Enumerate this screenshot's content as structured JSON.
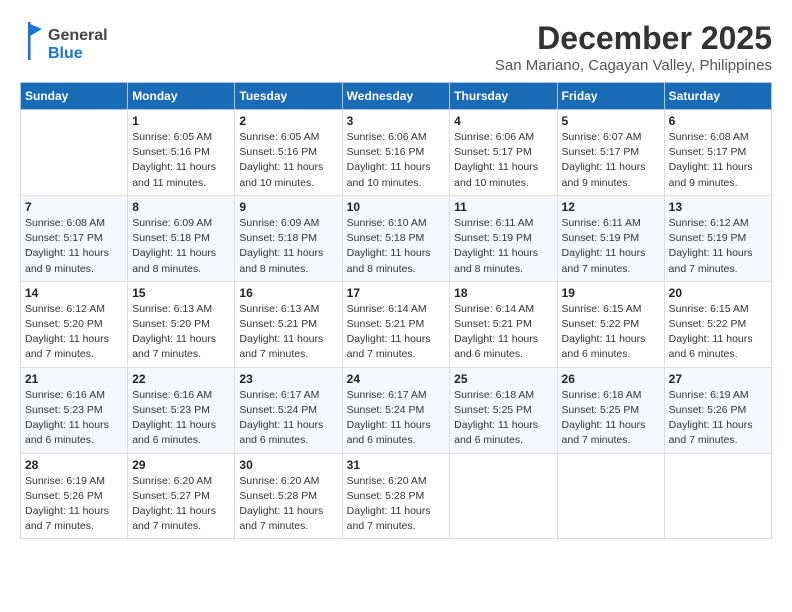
{
  "header": {
    "logo_line1": "General",
    "logo_line2": "Blue",
    "title": "December 2025",
    "subtitle": "San Mariano, Cagayan Valley, Philippines"
  },
  "weekdays": [
    "Sunday",
    "Monday",
    "Tuesday",
    "Wednesday",
    "Thursday",
    "Friday",
    "Saturday"
  ],
  "weeks": [
    [
      {
        "day": "",
        "sunrise": "",
        "sunset": "",
        "daylight": ""
      },
      {
        "day": "1",
        "sunrise": "Sunrise: 6:05 AM",
        "sunset": "Sunset: 5:16 PM",
        "daylight": "Daylight: 11 hours and 11 minutes."
      },
      {
        "day": "2",
        "sunrise": "Sunrise: 6:05 AM",
        "sunset": "Sunset: 5:16 PM",
        "daylight": "Daylight: 11 hours and 10 minutes."
      },
      {
        "day": "3",
        "sunrise": "Sunrise: 6:06 AM",
        "sunset": "Sunset: 5:16 PM",
        "daylight": "Daylight: 11 hours and 10 minutes."
      },
      {
        "day": "4",
        "sunrise": "Sunrise: 6:06 AM",
        "sunset": "Sunset: 5:17 PM",
        "daylight": "Daylight: 11 hours and 10 minutes."
      },
      {
        "day": "5",
        "sunrise": "Sunrise: 6:07 AM",
        "sunset": "Sunset: 5:17 PM",
        "daylight": "Daylight: 11 hours and 9 minutes."
      },
      {
        "day": "6",
        "sunrise": "Sunrise: 6:08 AM",
        "sunset": "Sunset: 5:17 PM",
        "daylight": "Daylight: 11 hours and 9 minutes."
      }
    ],
    [
      {
        "day": "7",
        "sunrise": "Sunrise: 6:08 AM",
        "sunset": "Sunset: 5:17 PM",
        "daylight": "Daylight: 11 hours and 9 minutes."
      },
      {
        "day": "8",
        "sunrise": "Sunrise: 6:09 AM",
        "sunset": "Sunset: 5:18 PM",
        "daylight": "Daylight: 11 hours and 8 minutes."
      },
      {
        "day": "9",
        "sunrise": "Sunrise: 6:09 AM",
        "sunset": "Sunset: 5:18 PM",
        "daylight": "Daylight: 11 hours and 8 minutes."
      },
      {
        "day": "10",
        "sunrise": "Sunrise: 6:10 AM",
        "sunset": "Sunset: 5:18 PM",
        "daylight": "Daylight: 11 hours and 8 minutes."
      },
      {
        "day": "11",
        "sunrise": "Sunrise: 6:11 AM",
        "sunset": "Sunset: 5:19 PM",
        "daylight": "Daylight: 11 hours and 8 minutes."
      },
      {
        "day": "12",
        "sunrise": "Sunrise: 6:11 AM",
        "sunset": "Sunset: 5:19 PM",
        "daylight": "Daylight: 11 hours and 7 minutes."
      },
      {
        "day": "13",
        "sunrise": "Sunrise: 6:12 AM",
        "sunset": "Sunset: 5:19 PM",
        "daylight": "Daylight: 11 hours and 7 minutes."
      }
    ],
    [
      {
        "day": "14",
        "sunrise": "Sunrise: 6:12 AM",
        "sunset": "Sunset: 5:20 PM",
        "daylight": "Daylight: 11 hours and 7 minutes."
      },
      {
        "day": "15",
        "sunrise": "Sunrise: 6:13 AM",
        "sunset": "Sunset: 5:20 PM",
        "daylight": "Daylight: 11 hours and 7 minutes."
      },
      {
        "day": "16",
        "sunrise": "Sunrise: 6:13 AM",
        "sunset": "Sunset: 5:21 PM",
        "daylight": "Daylight: 11 hours and 7 minutes."
      },
      {
        "day": "17",
        "sunrise": "Sunrise: 6:14 AM",
        "sunset": "Sunset: 5:21 PM",
        "daylight": "Daylight: 11 hours and 7 minutes."
      },
      {
        "day": "18",
        "sunrise": "Sunrise: 6:14 AM",
        "sunset": "Sunset: 5:21 PM",
        "daylight": "Daylight: 11 hours and 6 minutes."
      },
      {
        "day": "19",
        "sunrise": "Sunrise: 6:15 AM",
        "sunset": "Sunset: 5:22 PM",
        "daylight": "Daylight: 11 hours and 6 minutes."
      },
      {
        "day": "20",
        "sunrise": "Sunrise: 6:15 AM",
        "sunset": "Sunset: 5:22 PM",
        "daylight": "Daylight: 11 hours and 6 minutes."
      }
    ],
    [
      {
        "day": "21",
        "sunrise": "Sunrise: 6:16 AM",
        "sunset": "Sunset: 5:23 PM",
        "daylight": "Daylight: 11 hours and 6 minutes."
      },
      {
        "day": "22",
        "sunrise": "Sunrise: 6:16 AM",
        "sunset": "Sunset: 5:23 PM",
        "daylight": "Daylight: 11 hours and 6 minutes."
      },
      {
        "day": "23",
        "sunrise": "Sunrise: 6:17 AM",
        "sunset": "Sunset: 5:24 PM",
        "daylight": "Daylight: 11 hours and 6 minutes."
      },
      {
        "day": "24",
        "sunrise": "Sunrise: 6:17 AM",
        "sunset": "Sunset: 5:24 PM",
        "daylight": "Daylight: 11 hours and 6 minutes."
      },
      {
        "day": "25",
        "sunrise": "Sunrise: 6:18 AM",
        "sunset": "Sunset: 5:25 PM",
        "daylight": "Daylight: 11 hours and 6 minutes."
      },
      {
        "day": "26",
        "sunrise": "Sunrise: 6:18 AM",
        "sunset": "Sunset: 5:25 PM",
        "daylight": "Daylight: 11 hours and 7 minutes."
      },
      {
        "day": "27",
        "sunrise": "Sunrise: 6:19 AM",
        "sunset": "Sunset: 5:26 PM",
        "daylight": "Daylight: 11 hours and 7 minutes."
      }
    ],
    [
      {
        "day": "28",
        "sunrise": "Sunrise: 6:19 AM",
        "sunset": "Sunset: 5:26 PM",
        "daylight": "Daylight: 11 hours and 7 minutes."
      },
      {
        "day": "29",
        "sunrise": "Sunrise: 6:20 AM",
        "sunset": "Sunset: 5:27 PM",
        "daylight": "Daylight: 11 hours and 7 minutes."
      },
      {
        "day": "30",
        "sunrise": "Sunrise: 6:20 AM",
        "sunset": "Sunset: 5:28 PM",
        "daylight": "Daylight: 11 hours and 7 minutes."
      },
      {
        "day": "31",
        "sunrise": "Sunrise: 6:20 AM",
        "sunset": "Sunset: 5:28 PM",
        "daylight": "Daylight: 11 hours and 7 minutes."
      },
      {
        "day": "",
        "sunrise": "",
        "sunset": "",
        "daylight": ""
      },
      {
        "day": "",
        "sunrise": "",
        "sunset": "",
        "daylight": ""
      },
      {
        "day": "",
        "sunrise": "",
        "sunset": "",
        "daylight": ""
      }
    ]
  ]
}
